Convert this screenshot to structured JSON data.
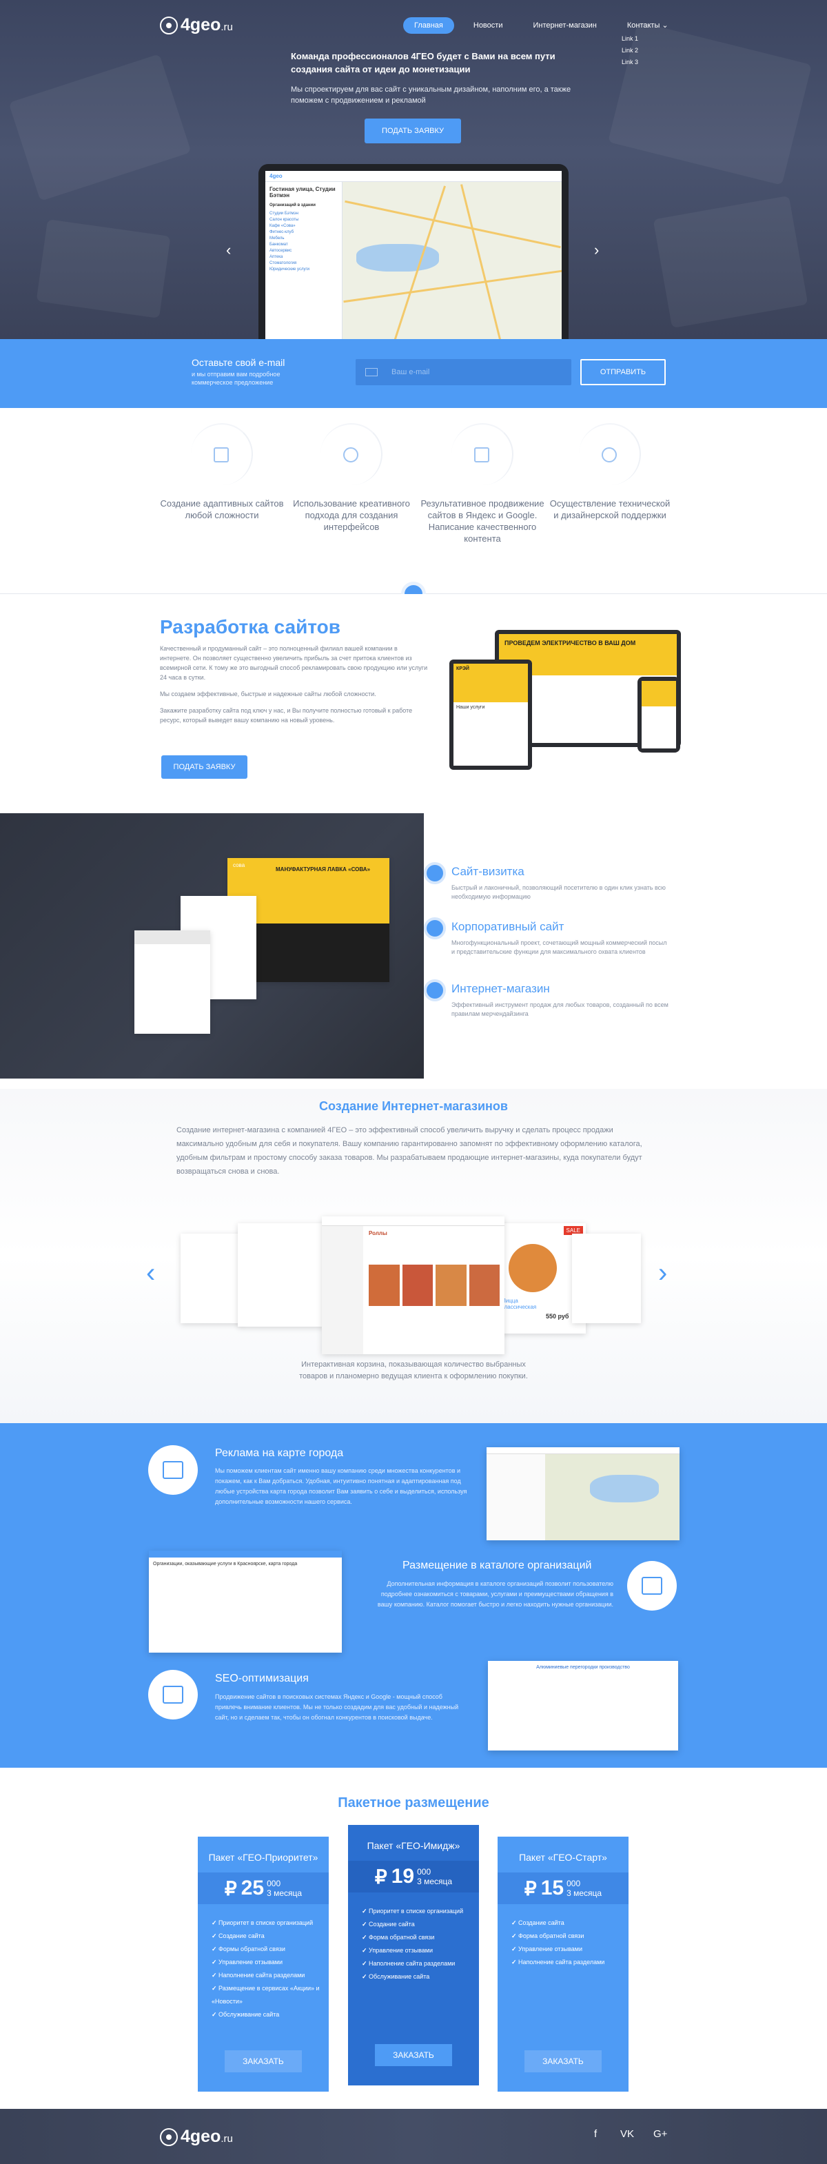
{
  "brand": {
    "name": "4geo",
    "tld": ".ru"
  },
  "nav": {
    "items": [
      "Главная",
      "Новости",
      "Интернет-магазин",
      "Контакты"
    ],
    "dropdown": [
      "Link 1",
      "Link 2",
      "Link 3"
    ]
  },
  "hero": {
    "title": "Команда профессионалов 4ГЕО будет с Вами на всем пути создания сайта от идеи до монетизации",
    "subtitle": "Мы спроектируем для вас сайт с уникальным дизайном, наполним его, а также поможем с продвижением и рекламой",
    "button": "ПОДАТЬ ЗАЯВКУ",
    "screen": {
      "logo": "4geo",
      "sidebar_title": "Гостиная улица, Студии Бэтмэн",
      "sidebar_header": "Организаций в здании",
      "sidebar_items": [
        "Студии Бэтмэн",
        "Салон красоты",
        "Кафе «Сова»",
        "Фитнес-клуб",
        "Мебель",
        "Банкомат",
        "Автосервис",
        "Аптека",
        "Стоматология",
        "Юридические услуги"
      ]
    }
  },
  "email": {
    "title": "Оставьте свой e-mail",
    "note": "и мы отправим вам подробное коммерческое предложение",
    "placeholder": "Ваш e-mail",
    "button": "ОТПРАВИТЬ"
  },
  "features": [
    "Создание адаптивных сайтов любой сложности",
    "Использование креативного подхода для создания интерфейсов",
    "Результативное продвижение сайтов в Яндекс и Google. Написание качественного контента",
    "Осуществление технической и дизайнерской поддержки"
  ],
  "webdev": {
    "title": "Разработка сайтов",
    "p1": "Качественный и продуманный сайт – это полноценный филиал вашей компании в интернете. Он позволяет существенно увеличить прибыль за счет притока клиентов из всемирной сети. К тому же это выгодный способ рекламировать свою продукцию или услуги 24 часа в сутки.",
    "p2": "Мы создаем эффективные, быстрые и надежные сайты любой сложности.",
    "p3": "Закажите разработку сайта под ключ у нас, и Вы получите полностью готовый к работе ресурс, который выведет вашу компанию на новый уровень.",
    "button": "ПОДАТЬ ЗАЯВКУ",
    "device_text": [
      "ПРОВЕДЕМ ЭЛЕКТРИЧЕСТВО В ВАШ ДОМ",
      "Наши услуги",
      "КРЭЙ"
    ]
  },
  "services": [
    {
      "title": "Сайт-визитка",
      "desc": "Быстрый и лаконичный, позволяющий посетителю в один клик узнать всю необходимую информацию"
    },
    {
      "title": "Корпоративный сайт",
      "desc": "Многофункциональный проект, сочетающий мощный коммерческий посыл и представительские функции для максимального охвата клиентов"
    },
    {
      "title": "Интернет-магазин",
      "desc": "Эффективный инструмент продаж для любых товаров, созданный по всем правилам мерчендайзинга"
    }
  ],
  "services_shot": {
    "headline": "МАНУФАКТУРНАЯ ЛАВКА «СОВА»",
    "brand": "сова"
  },
  "eshop": {
    "title": "Создание Интернет-магазинов",
    "text": "Создание интернет-магазина с компанией 4ГЕО – это эффективный способ увеличить выручку и сделать процесс продажи максимально удобным для себя и покупателя. Вашу компанию гарантированно запомнят по эффективному оформлению каталога, удобным фильтрам и простому способу заказа товаров. Мы разрабатываем продающие интернет-магазины, куда покупатели будут возвращаться снова и снова.",
    "caption": "Интерактивная корзина, показывающая количество выбранных товаров и планомерно ведущая клиента к оформлению покупки.",
    "cards": {
      "main": "Роллы",
      "pizza": "Пицца классическая",
      "price": "550 руб",
      "sale": "SALE"
    }
  },
  "blue_features": [
    {
      "title": "Реклама на карте города",
      "text": "Мы поможем клиентам сайт именно вашу компанию среди множества конкурентов и покажем, как к Вам добраться. Удобная, интуитивно понятная и адаптированная под любые устройства карта города позволит Вам заявить о себе и выделиться, используя дополнительные возможности нашего сервиса."
    },
    {
      "title": "Размещение в каталоге организаций",
      "text": "Дополнительная информация в каталоге организаций позволит пользователю подробнее ознакомиться с товарами, услугами и преимуществами обращения в вашу компанию. Каталог помогает быстро и легко находить нужные организации."
    },
    {
      "title": "SEO-оптимизация",
      "text": "Продвижение сайтов в поисковых системах Яндекс и Google - мощный способ привлечь внимание клиентов. Мы не только создадим для вас удобный и надежный сайт, но и сделаем так, чтобы он обогнал конкурентов в поисковой выдаче."
    }
  ],
  "catalog_shot": {
    "title": "Организации, оказывающие услуги в Красноярске, карта города"
  },
  "seo_shot": {
    "title": "Алюминиевые перегородки производство"
  },
  "pricing": {
    "title": "Пакетное размещение",
    "currency": "₽",
    "plans": [
      {
        "name": "Пакет «ГЕО-Приоритет»",
        "price": "25",
        "thousands": "000",
        "period": "3 месяца",
        "features": [
          "Приоритет в списке организаций",
          "Создание сайта",
          "Формы обратной связи",
          "Управление отзывами",
          "Наполнение сайта разделами",
          "Размещение в сервисах «Акции» и «Новости»",
          "Обслуживание сайта"
        ],
        "button": "ЗАКАЗАТЬ"
      },
      {
        "name": "Пакет «ГЕО-Имидж»",
        "price": "19",
        "thousands": "000",
        "period": "3 месяца",
        "features": [
          "Приоритет в списке организаций",
          "Создание сайта",
          "Форма обратной связи",
          "Управление отзывами",
          "Наполнение сайта разделами",
          "Обслуживание сайта"
        ],
        "button": "ЗАКАЗАТЬ"
      },
      {
        "name": "Пакет «ГЕО-Старт»",
        "price": "15",
        "thousands": "000",
        "period": "3 месяца",
        "features": [
          "Создание сайта",
          "Форма обратной связи",
          "Управление отзывами",
          "Наполнение сайта разделами"
        ],
        "button": "ЗАКАЗАТЬ"
      }
    ]
  },
  "footer": {
    "social": [
      "f",
      "VK",
      "G+"
    ]
  }
}
